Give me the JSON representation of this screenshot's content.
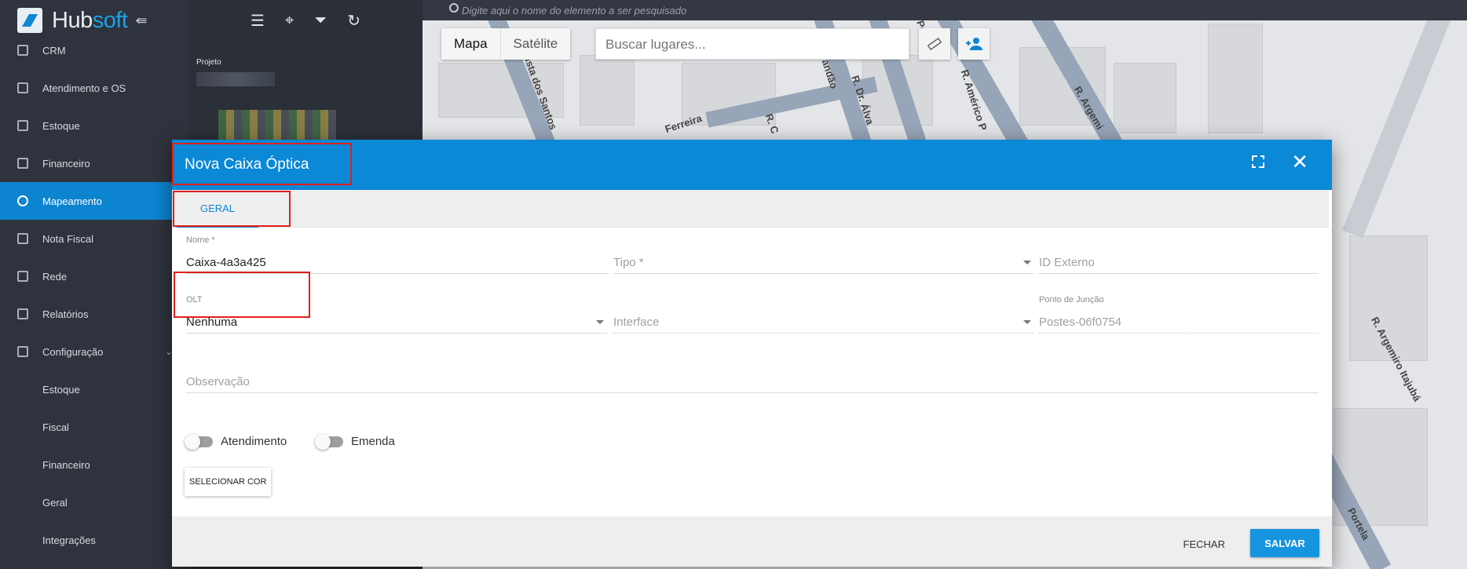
{
  "app": {
    "brand_main": "Hub",
    "brand_accent": "soft",
    "brand_color": "#1aa3e8",
    "collapse_icon": "arrow-left-bars-icon"
  },
  "sidebar": {
    "items": [
      {
        "label": "CRM",
        "icon": "crm-icon"
      },
      {
        "label": "Atendimento e OS",
        "icon": "service-icon"
      },
      {
        "label": "Estoque",
        "icon": "box-icon"
      },
      {
        "label": "Financeiro",
        "icon": "money-icon"
      },
      {
        "label": "Mapeamento",
        "icon": "map-pin-icon",
        "active": true
      },
      {
        "label": "Nota Fiscal",
        "icon": "document-icon"
      },
      {
        "label": "Rede",
        "icon": "server-icon"
      },
      {
        "label": "Relatórios",
        "icon": "report-icon"
      },
      {
        "label": "Configuração",
        "icon": "gear-icon",
        "expanded": true
      }
    ],
    "subitems": [
      "Estoque",
      "Fiscal",
      "Financeiro",
      "Geral",
      "Integrações"
    ],
    "active_color": "#0d84cf"
  },
  "panel2": {
    "toolbar_icons": [
      "menu-icon",
      "location-pin-icon",
      "filter-icon",
      "refresh-icon"
    ],
    "projeto_label": "Projeto"
  },
  "map": {
    "search_placeholder": "Digite aqui o nome do elemento a ser pesquisado",
    "type_buttons": [
      "Mapa",
      "Satélite"
    ],
    "places_placeholder": "Buscar lugares...",
    "street_labels": [
      "R. Dr. Álva",
      "R. Américo P",
      "R. Argemiro Itajubá",
      "R. Argemi",
      "Portela",
      "Portela",
      "Ferreira",
      "tista dos Santos",
      "Brandão",
      "R. C"
    ]
  },
  "modal": {
    "title": "Nova Caixa Óptica",
    "header_color": "#0b88d6",
    "tabs": [
      "GERAL"
    ],
    "fields": {
      "nome": {
        "label": "Nome *",
        "value": "Caixa-4a3a425"
      },
      "tipo": {
        "placeholder": "Tipo *"
      },
      "id_externo": {
        "placeholder": "ID Externo"
      },
      "olt": {
        "label": "OLT",
        "value": "Nenhuma"
      },
      "interface": {
        "placeholder": "Interface"
      },
      "ponto_juncao": {
        "label": "Ponto de Junção",
        "value": "Postes-06f0754"
      },
      "observacao": {
        "placeholder": "Observação"
      }
    },
    "toggles": [
      {
        "label": "Atendimento",
        "on": false
      },
      {
        "label": "Emenda",
        "on": false
      }
    ],
    "color_button": "SELECIONAR COR",
    "footer": {
      "close_label": "FECHAR",
      "save_label": "SALVAR",
      "save_color": "#1594e0"
    }
  }
}
